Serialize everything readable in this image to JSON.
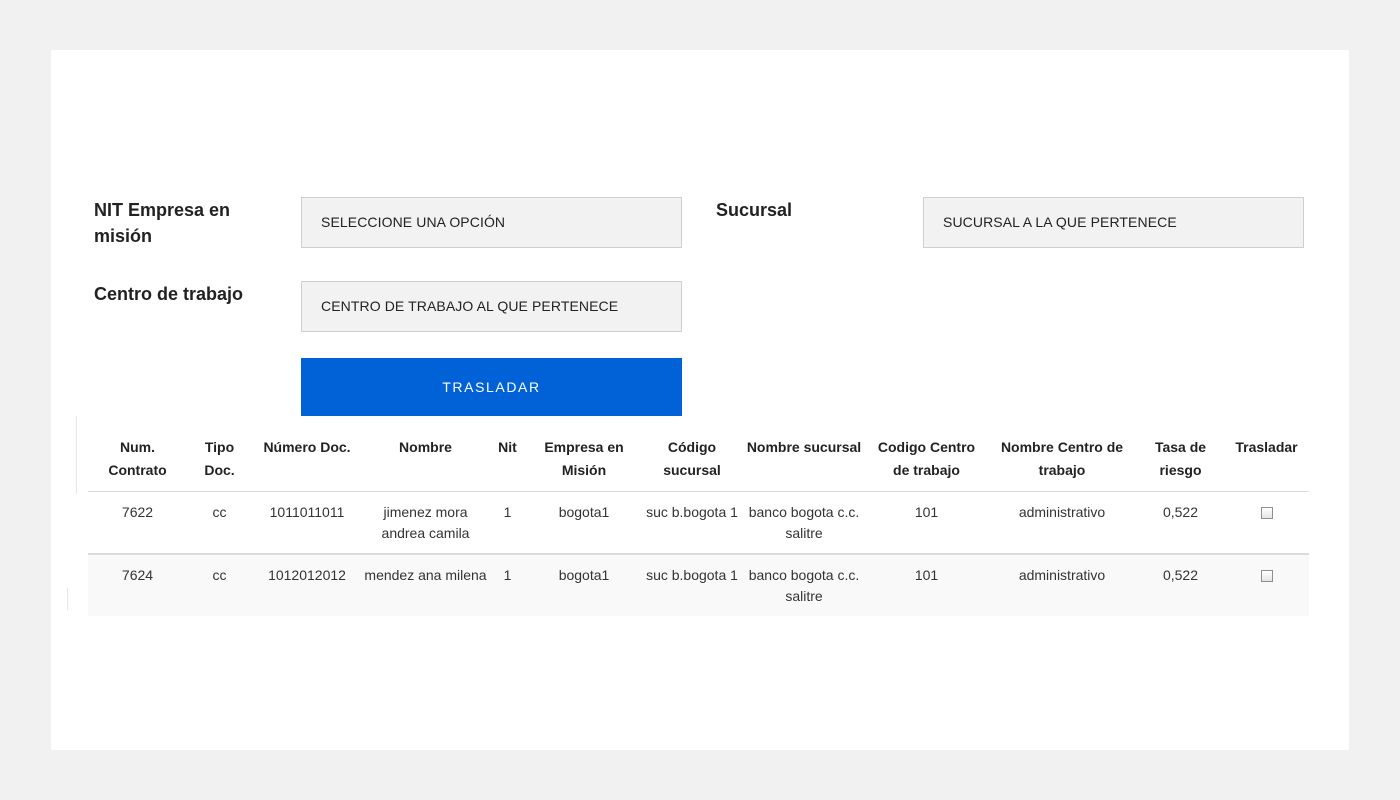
{
  "form": {
    "nit_label": "NIT Empresa en misión",
    "nit_select": "SELECCIONE UNA OPCIÓN",
    "sucursal_label": "Sucursal",
    "sucursal_select": "SUCURSAL A LA QUE PERTENECE",
    "centro_label": "Centro de trabajo",
    "centro_select": "CENTRO DE TRABAJO AL QUE PERTENECE",
    "button_label": "TRASLADAR"
  },
  "table": {
    "headers": [
      "Num. Contrato",
      "Tipo Doc.",
      "Número Doc.",
      "Nombre",
      "Nit",
      "Empresa en Misión",
      "Código sucursal",
      "Nombre sucursal",
      "Codigo Centro de trabajo",
      "Nombre Centro de trabajo",
      "Tasa de riesgo",
      "Trasladar"
    ],
    "rows": [
      {
        "contrato": "7622",
        "tipo_doc": "cc",
        "numero_doc": "1011011011",
        "nombre": "jimenez mora andrea camila",
        "nit": "1",
        "empresa": "bogota1",
        "codigo_sucursal": "suc b.bogota 1",
        "nombre_sucursal": "banco bogota c.c. salitre",
        "codigo_centro": "101",
        "nombre_centro": "administrativo",
        "tasa": "0,522",
        "trasladar": false
      },
      {
        "contrato": "7624",
        "tipo_doc": "cc",
        "numero_doc": "1012012012",
        "nombre": "mendez ana milena",
        "nit": "1",
        "empresa": "bogota1",
        "codigo_sucursal": "suc b.bogota 1",
        "nombre_sucursal": "banco bogota c.c. salitre",
        "codigo_centro": "101",
        "nombre_centro": "administrativo",
        "tasa": "0,522",
        "trasladar": false
      }
    ]
  },
  "colors": {
    "page_background": "#f1f1f1",
    "card_background": "#ffffff",
    "select_background": "#f2f2f2",
    "button_background": "#0062d6",
    "button_text": "#ffffff"
  }
}
